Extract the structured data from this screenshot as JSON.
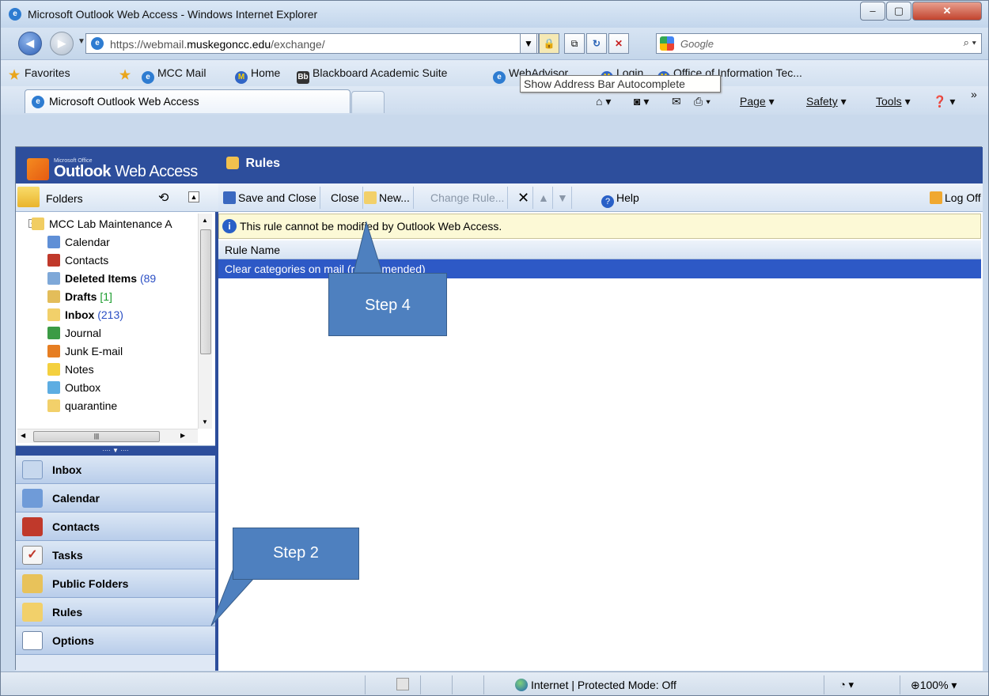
{
  "browser": {
    "window_title": "Microsoft Outlook Web Access - Windows Internet Explorer",
    "url_prefix": "https://webmail.",
    "url_domain": "muskegoncc.edu",
    "url_path": "/exchange/",
    "search_placeholder": "Google",
    "tooltip": "Show Address Bar Autocomplete",
    "favorites": {
      "label": "Favorites",
      "items": [
        "MCC Mail",
        "Home",
        "Blackboard Academic Suite",
        "WebAdvisor",
        "Login",
        "Office of Information Tec..."
      ]
    },
    "tab_title": "Microsoft Outlook Web Access",
    "commands": {
      "page": "Page",
      "safety": "Safety",
      "tools": "Tools"
    },
    "status": {
      "zone": "Internet | Protected Mode: Off",
      "zoom": "100%"
    }
  },
  "owa": {
    "logo_small": "Microsoft Office",
    "logo_bold": "Outlook",
    "logo_rest": " Web Access",
    "page_title": "Rules",
    "folders_label": "Folders",
    "mailbox": "MCC Lab Maintenance A",
    "tree": [
      {
        "label": "Calendar",
        "bold": false,
        "count": ""
      },
      {
        "label": "Contacts",
        "bold": false,
        "count": ""
      },
      {
        "label": "Deleted Items",
        "bold": true,
        "count": "(89"
      },
      {
        "label": "Drafts",
        "bold": true,
        "count": "[1]"
      },
      {
        "label": "Inbox",
        "bold": true,
        "count": "(213)"
      },
      {
        "label": "Journal",
        "bold": false,
        "count": ""
      },
      {
        "label": "Junk E-mail",
        "bold": false,
        "count": ""
      },
      {
        "label": "Notes",
        "bold": false,
        "count": ""
      },
      {
        "label": "Outbox",
        "bold": false,
        "count": ""
      },
      {
        "label": "quarantine",
        "bold": false,
        "count": ""
      }
    ],
    "nav": [
      "Inbox",
      "Calendar",
      "Contacts",
      "Tasks",
      "Public Folders",
      "Rules",
      "Options"
    ],
    "toolbar": {
      "save_close": "Save and Close",
      "close": "Close",
      "new": "New...",
      "change_rule": "Change Rule...",
      "help": "Help",
      "logoff": "Log Off"
    },
    "info_message": "This rule cannot be modified by Outlook Web Access.",
    "column_header": "Rule Name",
    "rules": [
      "Clear categories on mail (recommended)"
    ]
  },
  "callouts": {
    "step4": "Step 4",
    "step2": "Step 2"
  },
  "colors": {
    "owa_blue": "#2d4e9c",
    "selected_row": "#2d59c6",
    "callout": "#4e80bf",
    "info_bg": "#fcf9d6"
  }
}
